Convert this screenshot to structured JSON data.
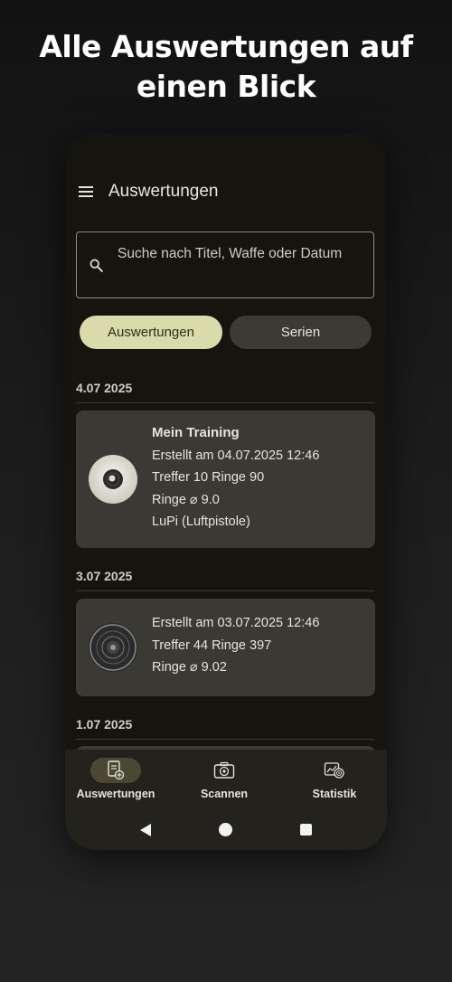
{
  "headline": {
    "line1": "Alle Auswertungen auf",
    "line2": "einen Blick"
  },
  "appbar": {
    "title": "Auswertungen"
  },
  "search": {
    "placeholder": "Suche nach Titel, Waffe oder Datum"
  },
  "segments": {
    "active": "Auswertungen",
    "inactive": "Serien"
  },
  "groups": [
    {
      "date": "4.07 2025",
      "card": {
        "title": "Mein Training",
        "created": "Erstellt am 04.07.2025 12:46",
        "stats": "Treffer 10  Ringe 90",
        "avg": "Ringe ⌀ 9.0",
        "weapon": "LuPi (Luftpistole)"
      }
    },
    {
      "date": "3.07 2025",
      "card": {
        "created": "Erstellt am 03.07.2025 12:46",
        "stats": "Treffer 44  Ringe 397",
        "avg": "Ringe ⌀ 9.02"
      }
    },
    {
      "date": "1.07 2025"
    }
  ],
  "bottom_nav": [
    {
      "label": "Auswertungen",
      "icon": "document-plus-icon",
      "active": true
    },
    {
      "label": "Scannen",
      "icon": "camera-target-icon",
      "active": false
    },
    {
      "label": "Statistik",
      "icon": "chart-target-icon",
      "active": false
    }
  ],
  "colors": {
    "accent": "#d9dcaa",
    "card": "#3a3933",
    "background": "#15140f"
  }
}
